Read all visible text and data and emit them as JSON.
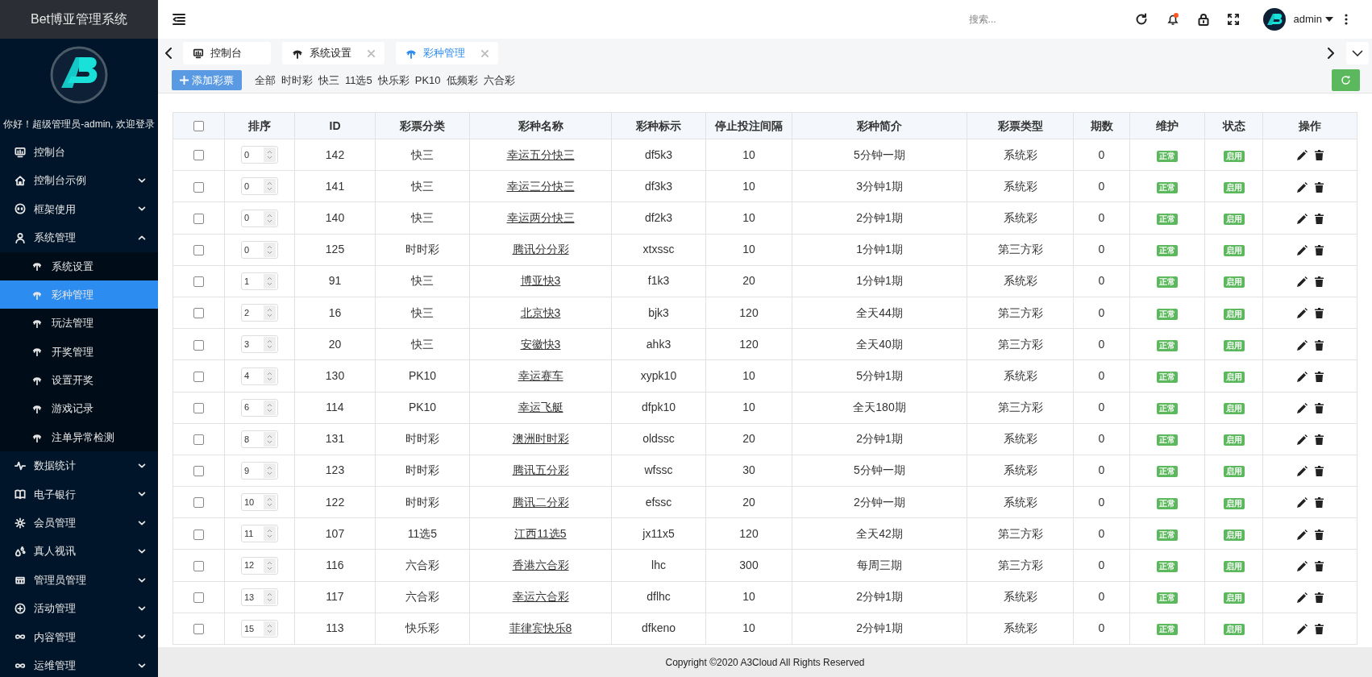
{
  "sidebar": {
    "title": "Bet博亚管理系统",
    "greeting": "你好！超级管理员-admin, 欢迎登录",
    "menu": [
      {
        "label": "控制台",
        "kind": "link"
      },
      {
        "label": "控制台示例",
        "kind": "group",
        "expanded": false
      },
      {
        "label": "框架使用",
        "kind": "group",
        "expanded": false
      },
      {
        "label": "系统管理",
        "kind": "group",
        "expanded": true,
        "children": [
          {
            "label": "系统设置",
            "selected": false
          },
          {
            "label": "彩种管理",
            "selected": true
          },
          {
            "label": "玩法管理",
            "selected": false
          },
          {
            "label": "开奖管理",
            "selected": false
          },
          {
            "label": "设置开奖",
            "selected": false
          },
          {
            "label": "游戏记录",
            "selected": false
          },
          {
            "label": "注单异常检测",
            "selected": false
          }
        ]
      },
      {
        "label": "数据统计",
        "kind": "group",
        "expanded": false
      },
      {
        "label": "电子银行",
        "kind": "group",
        "expanded": false
      },
      {
        "label": "会员管理",
        "kind": "group",
        "expanded": false
      },
      {
        "label": "真人视讯",
        "kind": "group",
        "expanded": false
      },
      {
        "label": "管理员管理",
        "kind": "group",
        "expanded": false
      },
      {
        "label": "活动管理",
        "kind": "group",
        "expanded": false
      },
      {
        "label": "内容管理",
        "kind": "group",
        "expanded": false
      },
      {
        "label": "运维管理",
        "kind": "group",
        "expanded": false
      }
    ]
  },
  "header": {
    "search": {
      "placeholder": "搜索..."
    },
    "user": "admin",
    "notification": true
  },
  "tabs": [
    {
      "label": "控制台",
      "selected": false,
      "closable": false
    },
    {
      "label": "系统设置",
      "selected": false,
      "closable": true
    },
    {
      "label": "彩种管理",
      "selected": true,
      "closable": true
    }
  ],
  "toolbar": {
    "add_button": "添加彩票",
    "filters": [
      "全部",
      "时时彩",
      "快三",
      "11选5",
      "快乐彩",
      "PK10",
      "低频彩",
      "六合彩"
    ]
  },
  "table": {
    "header_checked": false,
    "columns": [
      "排序",
      "ID",
      "彩票分类",
      "彩种名称",
      "彩种标示",
      "停止投注间隔",
      "彩种简介",
      "彩票类型",
      "期数",
      "维护",
      "状态",
      "操作"
    ],
    "rows": [
      {
        "checked": false,
        "sort": "0",
        "id": "142",
        "category": "快三",
        "name": "幸运五分快三",
        "code": "df5k3",
        "interval": "10",
        "intro": "5分钟一期",
        "type": "系统彩",
        "periods": "0",
        "maintenance": "正常",
        "status": "启用"
      },
      {
        "checked": false,
        "sort": "0",
        "id": "141",
        "category": "快三",
        "name": "幸运三分快三",
        "code": "df3k3",
        "interval": "10",
        "intro": "3分钟1期",
        "type": "系统彩",
        "periods": "0",
        "maintenance": "正常",
        "status": "启用"
      },
      {
        "checked": false,
        "sort": "0",
        "id": "140",
        "category": "快三",
        "name": "幸运两分快三",
        "code": "df2k3",
        "interval": "10",
        "intro": "2分钟1期",
        "type": "系统彩",
        "periods": "0",
        "maintenance": "正常",
        "status": "启用"
      },
      {
        "checked": false,
        "sort": "0",
        "id": "125",
        "category": "时时彩",
        "name": "腾讯分分彩",
        "code": "xtxssc",
        "interval": "10",
        "intro": "1分钟1期",
        "type": "第三方彩",
        "periods": "0",
        "maintenance": "正常",
        "status": "启用"
      },
      {
        "checked": false,
        "sort": "1",
        "id": "91",
        "category": "快三",
        "name": "博亚快3",
        "code": "f1k3",
        "interval": "20",
        "intro": "1分钟1期",
        "type": "系统彩",
        "periods": "0",
        "maintenance": "正常",
        "status": "启用"
      },
      {
        "checked": false,
        "sort": "2",
        "id": "16",
        "category": "快三",
        "name": "北京快3",
        "code": "bjk3",
        "interval": "120",
        "intro": "全天44期",
        "type": "第三方彩",
        "periods": "0",
        "maintenance": "正常",
        "status": "启用"
      },
      {
        "checked": false,
        "sort": "3",
        "id": "20",
        "category": "快三",
        "name": "安徽快3",
        "code": "ahk3",
        "interval": "120",
        "intro": "全天40期",
        "type": "第三方彩",
        "periods": "0",
        "maintenance": "正常",
        "status": "启用"
      },
      {
        "checked": false,
        "sort": "4",
        "id": "130",
        "category": "PK10",
        "name": "幸运赛车",
        "code": "xypk10",
        "interval": "10",
        "intro": "5分钟1期",
        "type": "系统彩",
        "periods": "0",
        "maintenance": "正常",
        "status": "启用"
      },
      {
        "checked": false,
        "sort": "6",
        "id": "114",
        "category": "PK10",
        "name": "幸运飞艇",
        "code": "dfpk10",
        "interval": "10",
        "intro": "全天180期",
        "type": "第三方彩",
        "periods": "0",
        "maintenance": "正常",
        "status": "启用"
      },
      {
        "checked": false,
        "sort": "8",
        "id": "131",
        "category": "时时彩",
        "name": "澳洲时时彩",
        "code": "oldssc",
        "interval": "20",
        "intro": "2分钟1期",
        "type": "系统彩",
        "periods": "0",
        "maintenance": "正常",
        "status": "启用"
      },
      {
        "checked": false,
        "sort": "9",
        "id": "123",
        "category": "时时彩",
        "name": "腾讯五分彩",
        "code": "wfssc",
        "interval": "30",
        "intro": "5分钟一期",
        "type": "系统彩",
        "periods": "0",
        "maintenance": "正常",
        "status": "启用"
      },
      {
        "checked": false,
        "sort": "10",
        "id": "122",
        "category": "时时彩",
        "name": "腾讯二分彩",
        "code": "efssc",
        "interval": "20",
        "intro": "2分钟一期",
        "type": "系统彩",
        "periods": "0",
        "maintenance": "正常",
        "status": "启用"
      },
      {
        "checked": false,
        "sort": "11",
        "id": "107",
        "category": "11选5",
        "name": "江西11选5",
        "code": "jx11x5",
        "interval": "120",
        "intro": "全天42期",
        "type": "第三方彩",
        "periods": "0",
        "maintenance": "正常",
        "status": "启用"
      },
      {
        "checked": false,
        "sort": "12",
        "id": "116",
        "category": "六合彩",
        "name": "香港六合彩",
        "code": "lhc",
        "interval": "300",
        "intro": "每周三期",
        "type": "第三方彩",
        "periods": "0",
        "maintenance": "正常",
        "status": "启用"
      },
      {
        "checked": false,
        "sort": "13",
        "id": "117",
        "category": "六合彩",
        "name": "幸运六合彩",
        "code": "dflhc",
        "interval": "10",
        "intro": "2分钟1期",
        "type": "系统彩",
        "periods": "0",
        "maintenance": "正常",
        "status": "启用"
      },
      {
        "checked": false,
        "sort": "15",
        "id": "113",
        "category": "快乐彩",
        "name": "菲律宾快乐8",
        "code": "dfkeno",
        "interval": "10",
        "intro": "2分钟1期",
        "type": "系统彩",
        "periods": "0",
        "maintenance": "正常",
        "status": "启用"
      }
    ]
  },
  "footer": "Copyright ©2020 A3Cloud All Rights Reserved"
}
